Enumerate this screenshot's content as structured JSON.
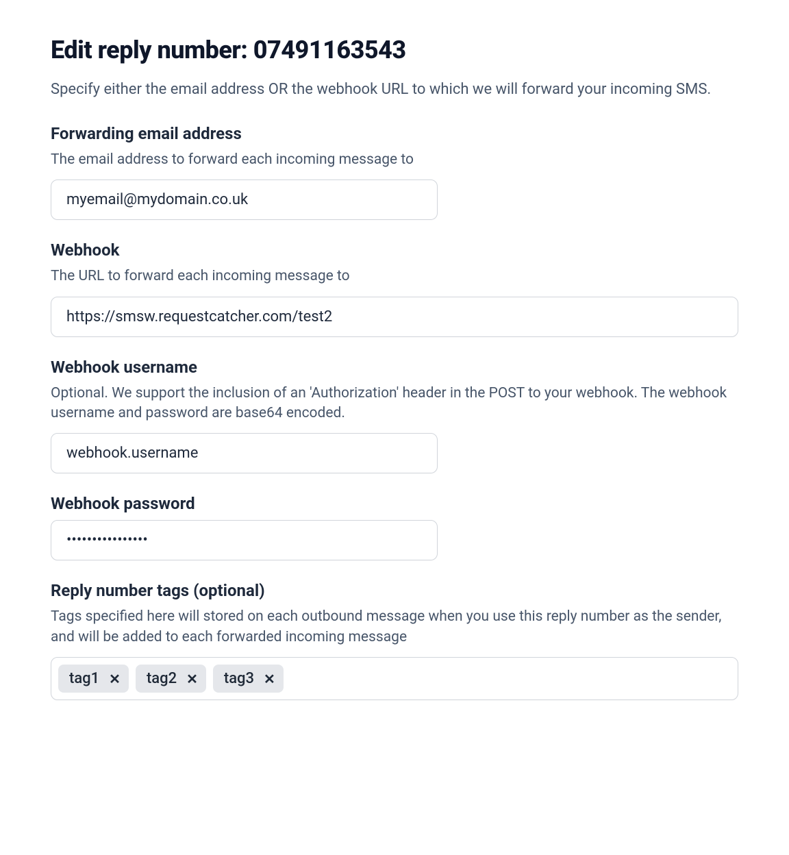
{
  "page": {
    "title": "Edit reply number: 07491163543",
    "description": "Specify either the email address OR the webhook URL to which we will forward your incoming SMS."
  },
  "forwarding_email": {
    "label": "Forwarding email address",
    "help": "The email address to forward each incoming message to",
    "value": "myemail@mydomain.co.uk"
  },
  "webhook": {
    "label": "Webhook",
    "help": "The URL to forward each incoming message to",
    "value": "https://smsw.requestcatcher.com/test2"
  },
  "webhook_username": {
    "label": "Webhook username",
    "help": "Optional. We support the inclusion of an 'Authorization' header in the POST to your webhook. The webhook username and password are base64 encoded.",
    "value": "webhook.username"
  },
  "webhook_password": {
    "label": "Webhook password",
    "value": "................"
  },
  "tags": {
    "label": "Reply number tags (optional)",
    "help": "Tags specified here will stored on each outbound message when you use this reply number as the sender, and will be added to each forwarded incoming message",
    "items": [
      "tag1",
      "tag2",
      "tag3"
    ]
  }
}
